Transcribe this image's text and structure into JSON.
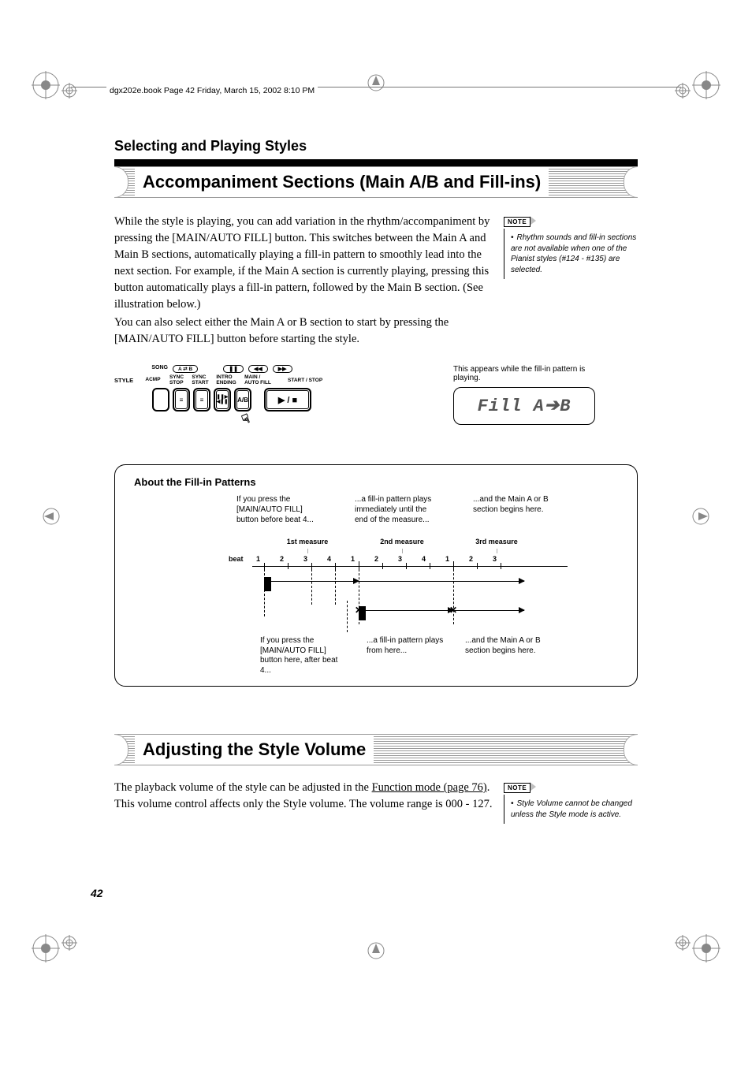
{
  "book_header": "dgx202e.book  Page 42  Friday, March 15, 2002  8:10 PM",
  "section_title": "Selecting and Playing Styles",
  "heading1": "Accompaniment Sections (Main A/B and Fill-ins)",
  "para1": "While the style is playing, you can add variation in the rhythm/accompaniment by pressing the [MAIN/AUTO FILL] button.  This switches between the Main A and Main B sections, automatically playing a fill-in pattern to smoothly lead into the next section.  For example, if the Main A section is currently playing, pressing this button automatically plays a fill-in pattern, followed by the Main B section.  (See illustration below.)",
  "para1b": "You can also select either the Main A or B section to start by pressing the [MAIN/AUTO FILL] button before starting the style.",
  "note1_label": "NOTE",
  "note1_text": "Rhythm sounds and fill-in sections are not available when one of the Pianist styles (#124 - #135) are selected.",
  "panel": {
    "song": "SONG",
    "ab_pill": "A ⇄ B",
    "pause": "❚❚",
    "rew": "◀◀",
    "ff": "▶▶",
    "style": "STYLE",
    "acmp": "ACMP",
    "sync_stop": "SYNC\nSTOP",
    "sync_start": "SYNC\nSTART",
    "intro_ending": "INTRO\nENDING",
    "main_autofill": "MAIN /\nAUTO FILL",
    "start_stop": "START / STOP",
    "btn_acmp": "",
    "btn_lines1": "≡",
    "btn_lines2": "≡",
    "btn_intro": "❚❚▶\n◀❚❚",
    "btn_ab": "A/B",
    "btn_play": "▶ / ■"
  },
  "lcd_label": "This appears while the fill-in pattern is playing.",
  "lcd_text": "Fill A➔B",
  "fillin": {
    "title": "About the Fill-in Patterns",
    "c1": "If you press the [MAIN/AUTO FILL] button before beat 4...",
    "c2": "...a fill-in pattern plays immediately until the end of the measure...",
    "c3": "...and the Main A or B section begins here.",
    "m1": "1st measure",
    "m2": "2nd measure",
    "m3": "3rd measure",
    "beat": "beat",
    "beats": [
      "1",
      "2",
      "3",
      "4",
      "1",
      "2",
      "3",
      "4",
      "1",
      "2",
      "3"
    ],
    "b1": "If you press the [MAIN/AUTO FILL] button here, after beat 4...",
    "b2": "...a fill-in pattern plays from here...",
    "b3": "...and the Main A or B section begins here."
  },
  "heading2": "Adjusting the Style Volume",
  "para2a": "The playback volume of the style can be adjusted in the ",
  "para2_link": "Function mode (page 76)",
  "para2b": ". This volume control affects only the Style volume.  The volume range is 000 - 127.",
  "note2_label": "NOTE",
  "note2_text": "Style Volume cannot be changed unless the Style mode is active.",
  "page_num": "42"
}
